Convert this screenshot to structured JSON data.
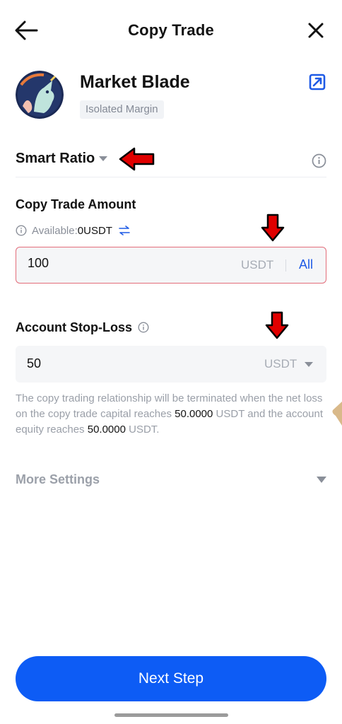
{
  "header": {
    "title": "Copy Trade",
    "back_icon": "arrow-left-icon",
    "close_icon": "close-icon"
  },
  "trader": {
    "name": "Market Blade",
    "badge": "Isolated Margin",
    "share_icon": "share-icon"
  },
  "mode": {
    "label": "Smart Ratio",
    "info_icon": "info-icon"
  },
  "amount": {
    "title": "Copy Trade Amount",
    "available_label": "Available:",
    "available_value": "0USDT",
    "value": "100",
    "unit": "USDT",
    "all_label": "All"
  },
  "stop_loss": {
    "title": "Account Stop-Loss",
    "value": "50",
    "unit": "USDT",
    "note_part1": "The copy trading relationship will be terminated when the net loss on the copy trade capital reaches ",
    "note_value1": "50.0000",
    "note_part2": " USDT and the account equity reaches ",
    "note_value2": "50.0000",
    "note_part3": " USDT."
  },
  "more_settings": {
    "label": "More Settings"
  },
  "footer": {
    "next_label": "Next Step"
  },
  "colors": {
    "primary": "#0d5cf5",
    "link": "#1e5ae6",
    "error_border": "#e36d7a",
    "annotation_arrow": "#e00000"
  }
}
